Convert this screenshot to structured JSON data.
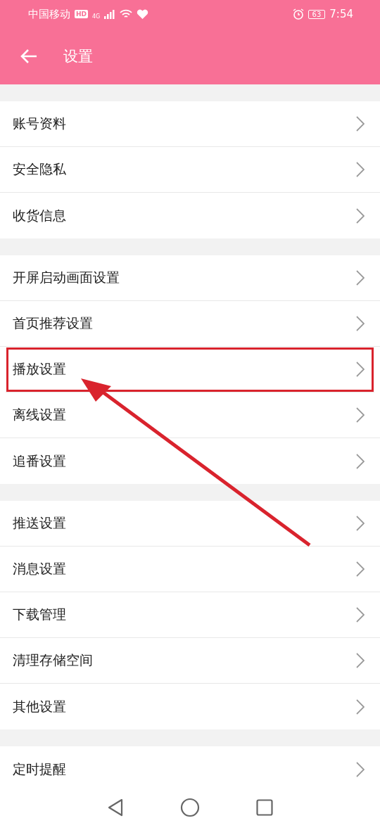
{
  "status_bar": {
    "carrier": "中国移动",
    "hd": "HD",
    "network": "4G",
    "battery": "63",
    "time": "7:54"
  },
  "header": {
    "title": "设置"
  },
  "sections": [
    {
      "items": [
        {
          "label": "账号资料",
          "highlighted": false
        },
        {
          "label": "安全隐私",
          "highlighted": false
        },
        {
          "label": "收货信息",
          "highlighted": false
        }
      ]
    },
    {
      "items": [
        {
          "label": "开屏启动画面设置",
          "highlighted": false
        },
        {
          "label": "首页推荐设置",
          "highlighted": false
        },
        {
          "label": "播放设置",
          "highlighted": true
        },
        {
          "label": "离线设置",
          "highlighted": false
        },
        {
          "label": "追番设置",
          "highlighted": false
        }
      ]
    },
    {
      "items": [
        {
          "label": "推送设置",
          "highlighted": false
        },
        {
          "label": "消息设置",
          "highlighted": false
        },
        {
          "label": "下载管理",
          "highlighted": false
        },
        {
          "label": "清理存储空间",
          "highlighted": false
        },
        {
          "label": "其他设置",
          "highlighted": false
        }
      ]
    },
    {
      "items": [
        {
          "label": "定时提醒",
          "highlighted": false
        }
      ]
    }
  ]
}
